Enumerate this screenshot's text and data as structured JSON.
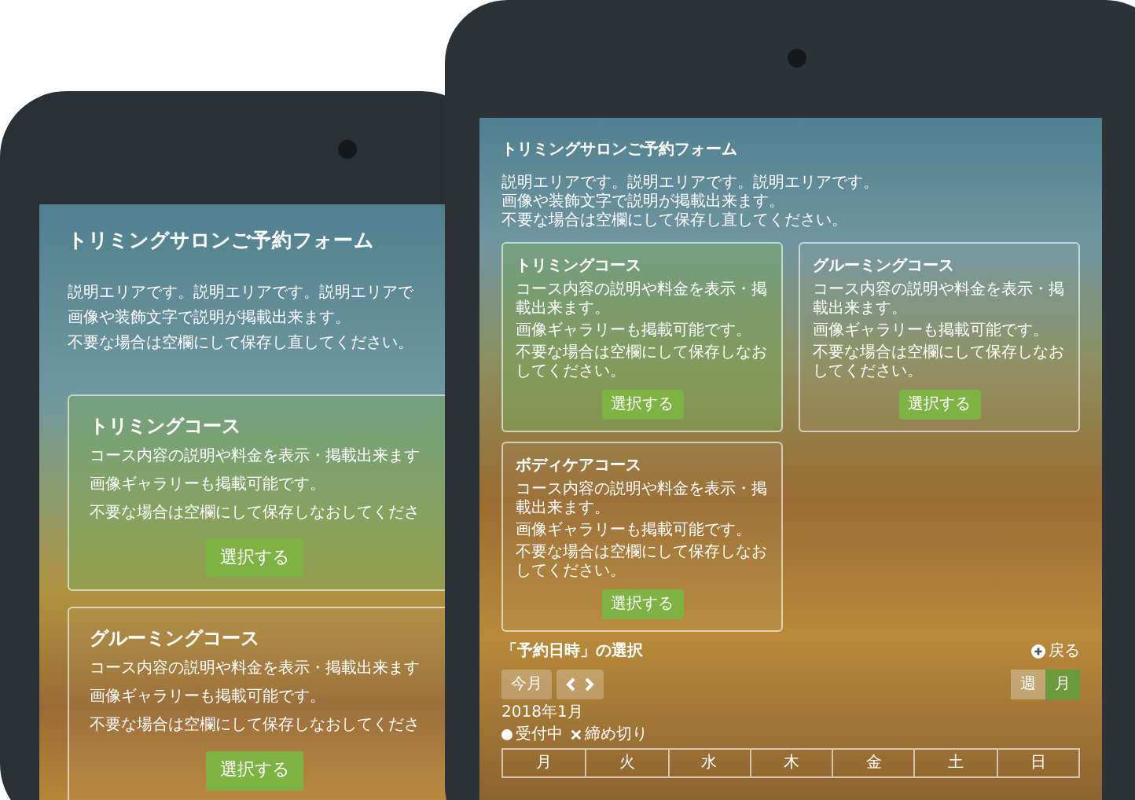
{
  "tablets": [
    {
      "title": "トリミングサロンご予約フォーム",
      "description": [
        "説明エリアです。説明エリアです。説明エリアで",
        "画像や装飾文字で説明が掲載出来ます。",
        "不要な場合は空欄にして保存し直してください。"
      ],
      "courses": [
        {
          "title": "トリミングコース",
          "description": [
            "コース内容の説明や料金を表示・掲載出来ます",
            "画像ギャラリーも掲載可能です。",
            "不要な場合は空欄にして保存しなおしてくださ"
          ],
          "button": "選択する",
          "selected": true
        },
        {
          "title": "グルーミングコース",
          "description": [
            "コース内容の説明や料金を表示・掲載出来ます",
            "画像ギャラリーも掲載可能です。",
            "不要な場合は空欄にして保存しなおしてくださ"
          ],
          "button": "選択する",
          "selected": false
        }
      ]
    },
    {
      "title": "トリミングサロンご予約フォーム",
      "description": [
        "説明エリアです。説明エリアです。説明エリアです。",
        "画像や装飾文字で説明が掲載出来ます。",
        "不要な場合は空欄にして保存し直してください。"
      ],
      "courses": [
        {
          "title": "トリミングコース",
          "description": [
            "コース内容の説明や料金を表示・掲載出来ます。",
            "画像ギャラリーも掲載可能です。",
            "不要な場合は空欄にして保存しなおしてください。"
          ],
          "button": "選択する",
          "selected": true
        },
        {
          "title": "グルーミングコース",
          "description": [
            "コース内容の説明や料金を表示・掲載出来ます。",
            "画像ギャラリーも掲載可能です。",
            "不要な場合は空欄にして保存しなおしてください。"
          ],
          "button": "選択する",
          "selected": false
        },
        {
          "title": "ボディケアコース",
          "description": [
            "コース内容の説明や料金を表示・掲載出来ます。",
            "画像ギャラリーも掲載可能です。",
            "不要な場合は空欄にして保存しなおしてください。"
          ],
          "button": "選択する",
          "selected": false
        }
      ],
      "calendar": {
        "heading": "「予約日時」の選択",
        "back": "戻る",
        "today": "今月",
        "views": [
          {
            "label": "週",
            "selected": false
          },
          {
            "label": "月",
            "selected": true
          }
        ],
        "month": "2018年1月",
        "legend": [
          {
            "kind": "open",
            "label": "受付中"
          },
          {
            "kind": "closed",
            "label": "締め切り"
          }
        ],
        "weekdays": [
          "月",
          "火",
          "水",
          "木",
          "金",
          "土",
          "日"
        ]
      }
    }
  ]
}
